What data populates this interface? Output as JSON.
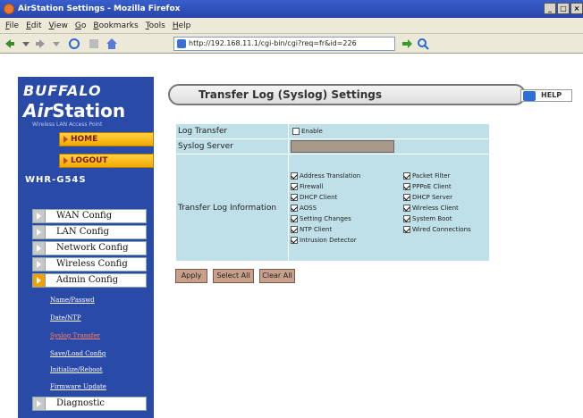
{
  "window": {
    "title": "AirStation Settings - Mozilla Firefox",
    "controls": [
      "_",
      "□",
      "×"
    ]
  },
  "menubar": [
    "File",
    "Edit",
    "View",
    "Go",
    "Bookmarks",
    "Tools",
    "Help"
  ],
  "address": {
    "url": "http://192.168.11.1/cgi-bin/cgi?req=fr&id=226"
  },
  "brand": {
    "line1": "BUFFALO",
    "line2a": "Air",
    "line2b": "Station",
    "tagline": "Wireless LAN Access Point",
    "model": "WHR-G54S"
  },
  "nav_buttons": {
    "home": "HOME",
    "logout": "LOGOUT"
  },
  "menu": [
    {
      "label": "WAN Config"
    },
    {
      "label": "LAN Config"
    },
    {
      "label": "Network Config"
    },
    {
      "label": "Wireless Config"
    },
    {
      "label": "Admin Config"
    },
    {
      "label": "Diagnostic"
    }
  ],
  "submenu": [
    "Name/Passwd",
    "Date/NTP",
    "Syslog Transfer",
    "Save/Load Config",
    "Initialize/Reboot",
    "Firmware Update"
  ],
  "header": {
    "title": "Transfer Log (Syslog) Settings",
    "help": "HELP"
  },
  "form": {
    "log_transfer_label": "Log Transfer",
    "enable_label": "Enable",
    "syslog_server_label": "Syslog Server",
    "syslog_server_value": "",
    "transfer_info_label": "Transfer Log Information",
    "options_left": [
      "Address Translation",
      "Firewall",
      "DHCP Client",
      "AOSS",
      "Setting Changes",
      "NTP Client",
      "Intrusion Detector"
    ],
    "options_right": [
      "Packet Filter",
      "PPPoE Client",
      "DHCP Server",
      "Wireless Client",
      "System Boot",
      "Wired Connections"
    ]
  },
  "buttons": {
    "apply": "Apply",
    "select_all": "Select All",
    "clear_all": "Clear All"
  },
  "colors": {
    "sidebar": "#2a4aa8",
    "table_bg": "#bfe0e8",
    "button_bg": "#c8a08a",
    "nav_yellow": "#f2a900"
  }
}
